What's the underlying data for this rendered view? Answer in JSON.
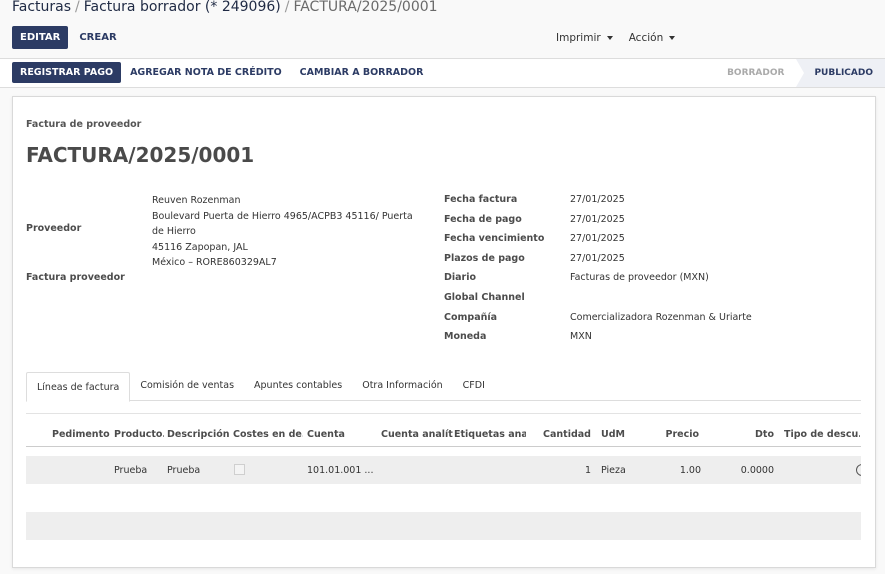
{
  "breadcrumb": {
    "root": "Facturas",
    "draft": "Factura borrador (* 249096)",
    "current": "FACTURA/2025/0001",
    "separator": "/"
  },
  "control_panel": {
    "edit_label": "EDITAR",
    "create_label": "CREAR",
    "print_label": "Imprimir",
    "action_label": "Acción"
  },
  "header_buttons": {
    "register_payment": "REGISTRAR PAGO",
    "add_credit_note": "AGREGAR NOTA DE CRÉDITO",
    "reset_to_draft": "CAMBIAR A BORRADOR"
  },
  "statusbar": {
    "stages": [
      "BORRADOR",
      "PUBLICADO"
    ],
    "active": "PUBLICADO"
  },
  "form": {
    "subtitle": "Factura de proveedor",
    "name": "FACTURA/2025/0001",
    "left": {
      "vendor_label": "Proveedor",
      "vendor_name": "Reuven Rozenman",
      "vendor_address_line1": "Boulevard Puerta de Hierro 4965/ACPB3 45116/ Puerta de Hierro",
      "vendor_address_line2": "45116 Zapopan, JAL",
      "vendor_address_line3": "México – RORE860329AL7",
      "vendor_ref_label": "Factura proveedor",
      "vendor_ref_value": ""
    },
    "right": [
      {
        "label": "Fecha factura",
        "value": "27/01/2025"
      },
      {
        "label": "Fecha de pago",
        "value": "27/01/2025"
      },
      {
        "label": "Fecha vencimiento",
        "value": "27/01/2025"
      },
      {
        "label": "Plazos de pago",
        "value": "27/01/2025"
      },
      {
        "label": "Diario",
        "value": "Facturas de proveedor (MXN)"
      },
      {
        "label": "Global Channel",
        "value": ""
      },
      {
        "label": "Compañía",
        "value": "Comercializadora Rozenman & Uriarte"
      },
      {
        "label": "Moneda",
        "value": "MXN"
      }
    ]
  },
  "tabs": [
    "Líneas de factura",
    "Comisión de ventas",
    "Apuntes contables",
    "Otra Información",
    "CFDI"
  ],
  "active_tab": "Líneas de factura",
  "lines": {
    "columns": [
      "Pedimento...",
      "Producto...",
      "Descripción...",
      "Costes en de...",
      "Cuenta",
      "Cuenta analíti...",
      "Etiquetas ana...",
      "Cantidad",
      "UdM",
      "Precio",
      "Dto",
      "Tipo de descu..."
    ],
    "rows": [
      {
        "pedimento": "",
        "producto": "Prueba",
        "descripcion": "Prueba",
        "costes_checked": false,
        "cuenta": "101.01.001 ...",
        "cuenta_analitica": "",
        "etiquetas": "",
        "cantidad": "1",
        "udm": "Pieza",
        "precio": "1.00",
        "dto": "0.0000",
        "tipo_descuento": ""
      }
    ]
  },
  "colors": {
    "primary": "#2c3b64",
    "row_shade": "#eeeeee",
    "background": "#f9f9f9"
  }
}
